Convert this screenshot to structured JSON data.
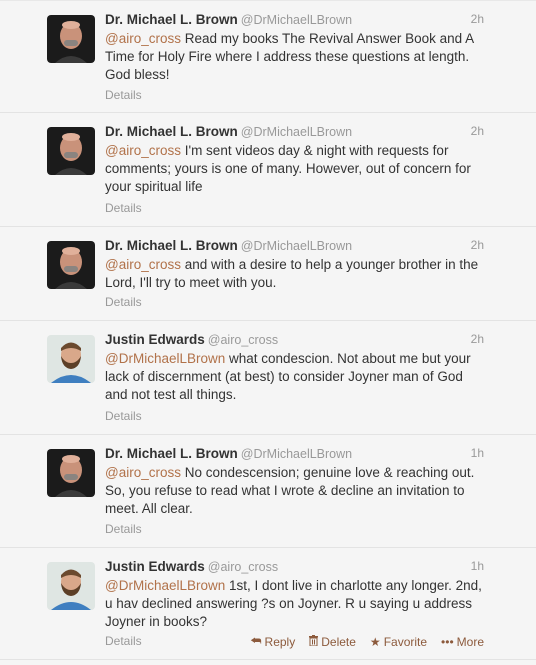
{
  "tweets": [
    {
      "name": "Dr. Michael L. Brown",
      "handle": "@DrMichaelLBrown",
      "time": "2h",
      "mention": "@airo_cross",
      "text": " Read my books The Revival Answer Book and A Time for Holy Fire where I address these questions at length. God bless!",
      "details": "Details",
      "avatar": "bald-man-avatar"
    },
    {
      "name": "Dr. Michael L. Brown",
      "handle": "@DrMichaelLBrown",
      "time": "2h",
      "mention": "@airo_cross",
      "text": " I'm sent videos day & night with requests for comments; yours is one of many. However, out of concern for your spiritual life",
      "details": "Details",
      "avatar": "bald-man-avatar"
    },
    {
      "name": "Dr. Michael L. Brown",
      "handle": "@DrMichaelLBrown",
      "time": "2h",
      "mention": "@airo_cross",
      "text": " and with a desire to help a younger brother in the Lord, I'll try to meet with you.",
      "details": "Details",
      "avatar": "bald-man-avatar"
    },
    {
      "name": "Justin Edwards",
      "handle": "@airo_cross",
      "time": "2h",
      "mention": "@DrMichaelLBrown",
      "text": " what condescion. Not about me but your lack of discernment (at best) to consider Joyner man of God and not test all things.",
      "details": "Details",
      "avatar": "bearded-man-avatar"
    },
    {
      "name": "Dr. Michael L. Brown",
      "handle": "@DrMichaelLBrown",
      "time": "1h",
      "mention": "@airo_cross",
      "text": " No condescension; genuine love & reaching out. So, you refuse to read what I wrote & decline an invitation to meet. All clear.",
      "details": "Details",
      "avatar": "bald-man-avatar"
    },
    {
      "name": "Justin Edwards",
      "handle": "@airo_cross",
      "time": "1h",
      "mention": "@DrMichaelLBrown",
      "text": " 1st, I dont live in charlotte any longer. 2nd, u hav declined answering ?s on Joyner. R u saying u address Joyner in books?",
      "details": "Details",
      "avatar": "bearded-man-avatar"
    }
  ],
  "actions": {
    "reply": "Reply",
    "delete": "Delete",
    "favorite": "Favorite",
    "more": "More",
    "reply_icon": "reply-arrow-icon",
    "delete_icon": "trash-icon",
    "favorite_icon": "star-icon",
    "more_icon": "ellipsis-icon"
  },
  "colors": {
    "mention": "#b1724a",
    "action": "#8c5a3c",
    "muted": "#999999",
    "background": "#f5f5f5"
  }
}
